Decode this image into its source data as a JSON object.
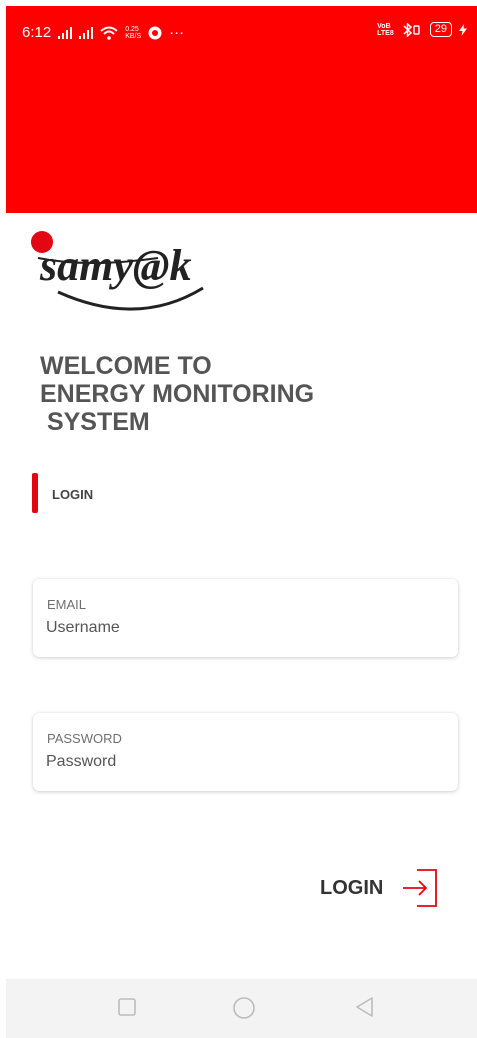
{
  "status_bar": {
    "time": "6:12",
    "speed_top": "0.25",
    "speed_bottom": "KB/S",
    "more": "···",
    "volte_top": "VoB",
    "volte_bottom": "LTE8",
    "battery": "29",
    "background": "#ff0000"
  },
  "logo": {
    "text": "samy@k"
  },
  "welcome": {
    "line1": "WELCOME TO",
    "line2": "ENERGY MONITORING",
    "line3": " SYSTEM"
  },
  "section": {
    "label": "LOGIN",
    "accent": "#e30613"
  },
  "email": {
    "caption": "EMAIL",
    "placeholder": "Username",
    "value": ""
  },
  "password": {
    "caption": "PASSWORD",
    "placeholder": "Password",
    "value": ""
  },
  "login_button": {
    "label": "LOGIN",
    "icon": "login-arrow-icon",
    "icon_color": "#e30613"
  },
  "nav": {
    "icons": [
      "square-icon",
      "circle-icon",
      "back-triangle-icon"
    ]
  }
}
